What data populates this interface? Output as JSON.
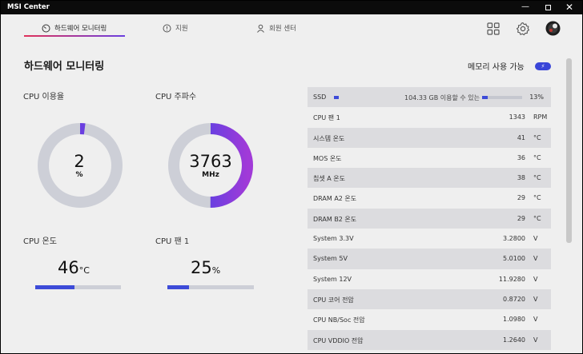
{
  "window": {
    "title": "MSI Center"
  },
  "nav": {
    "tabs": [
      {
        "label": "하드웨어 모니터링",
        "active": true
      },
      {
        "label": "지원",
        "active": false
      },
      {
        "label": "회원 센터",
        "active": false
      }
    ]
  },
  "page": {
    "title": "하드웨어 모니터링"
  },
  "cards": {
    "cpu_usage": {
      "label": "CPU 이용율",
      "value": "2",
      "unit": "%",
      "percent": 2
    },
    "cpu_freq": {
      "label": "CPU 주파수",
      "value": "3763",
      "unit": "MHz",
      "percent": 50
    },
    "cpu_temp": {
      "label": "CPU 온도",
      "value": "46",
      "unit": "°C",
      "percent": 46
    },
    "cpu_fan": {
      "label": "CPU 팬 1",
      "value": "25",
      "unit": "%",
      "percent": 25
    }
  },
  "memory": {
    "label": "메모리 사용 가능"
  },
  "ssd": {
    "name": "SSD",
    "desc": "104.33 GB 이용할 수 있는",
    "value": "13%",
    "percent": 13
  },
  "sensors": [
    {
      "name": "CPU 팬 1",
      "value": "1343",
      "unit": "RPM"
    },
    {
      "name": "시스템 온도",
      "value": "41",
      "unit": "°C"
    },
    {
      "name": "MOS 온도",
      "value": "36",
      "unit": "°C"
    },
    {
      "name": "칩셋 A 온도",
      "value": "38",
      "unit": "°C"
    },
    {
      "name": "DRAM A2 온도",
      "value": "29",
      "unit": "°C"
    },
    {
      "name": "DRAM B2 온도",
      "value": "29",
      "unit": "°C"
    },
    {
      "name": "System 3.3V",
      "value": "3.2800",
      "unit": "V"
    },
    {
      "name": "System 5V",
      "value": "5.0100",
      "unit": "V"
    },
    {
      "name": "System 12V",
      "value": "11.9280",
      "unit": "V"
    },
    {
      "name": "CPU 코어 전압",
      "value": "0.8720",
      "unit": "V"
    },
    {
      "name": "CPU NB/Soc 전압",
      "value": "1.0980",
      "unit": "V"
    },
    {
      "name": "CPU VDDIO 전압",
      "value": "1.2640",
      "unit": "V"
    }
  ],
  "colors": {
    "accent": "#3d4bd8",
    "gauge_track": "#cdcfd7",
    "gradient_start": "#e0315a",
    "gradient_end": "#6a3fe0"
  }
}
